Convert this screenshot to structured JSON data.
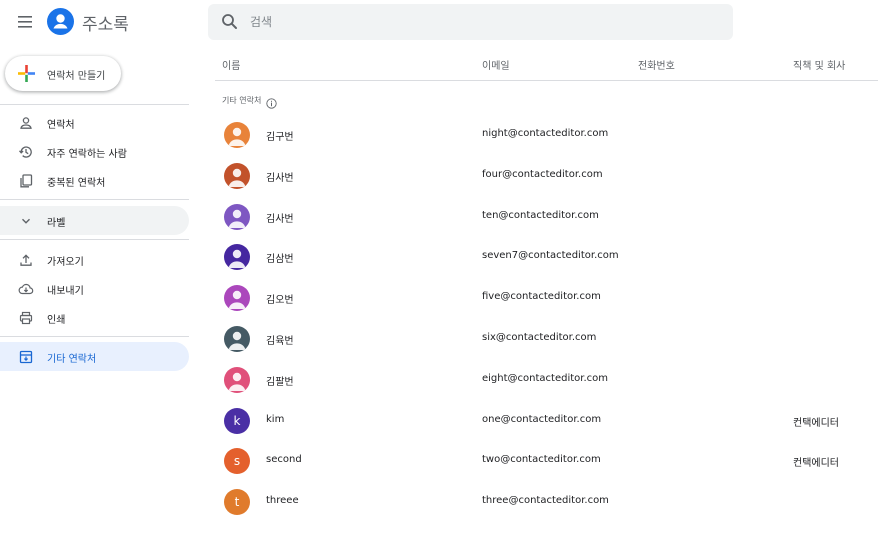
{
  "app": {
    "title": "주소록"
  },
  "search": {
    "placeholder": "검색"
  },
  "sidebar": {
    "create_label": "연락처 만들기",
    "items": [
      {
        "label": "연락처",
        "icon": "person-icon"
      },
      {
        "label": "자주 연락하는 사람",
        "icon": "history-icon"
      },
      {
        "label": "중복된 연락처",
        "icon": "copy-icon"
      },
      {
        "label": "라벨",
        "icon": "chevron-down-icon"
      },
      {
        "label": "가져오기",
        "icon": "upload-icon"
      },
      {
        "label": "내보내기",
        "icon": "cloud-download-icon"
      },
      {
        "label": "인쇄",
        "icon": "print-icon"
      },
      {
        "label": "기타 연락처",
        "icon": "archive-icon"
      }
    ]
  },
  "list": {
    "columns": {
      "name": "이름",
      "email": "이메일",
      "phone": "전화번호",
      "company": "직책 및 회사"
    },
    "section_title": "기타 연락처",
    "rows": [
      {
        "name": "김구번",
        "email": "night@contacteditor.com",
        "company": "",
        "avatar_color": "#e8833a",
        "letter": ""
      },
      {
        "name": "김사번",
        "email": "four@contacteditor.com",
        "company": "",
        "avatar_color": "#c2522b",
        "letter": ""
      },
      {
        "name": "김사번",
        "email": "ten@contacteditor.com",
        "company": "",
        "avatar_color": "#7e57c2",
        "letter": ""
      },
      {
        "name": "김삼번",
        "email": "seven7@contacteditor.com",
        "company": "",
        "avatar_color": "#4527a0",
        "letter": ""
      },
      {
        "name": "김오번",
        "email": "five@contacteditor.com",
        "company": "",
        "avatar_color": "#ab47bc",
        "letter": ""
      },
      {
        "name": "김육번",
        "email": "six@contacteditor.com",
        "company": "",
        "avatar_color": "#455a64",
        "letter": ""
      },
      {
        "name": "김팔번",
        "email": "eight@contacteditor.com",
        "company": "",
        "avatar_color": "#e0507a",
        "letter": ""
      },
      {
        "name": "kim",
        "email": "one@contacteditor.com",
        "company": "컨택에디터",
        "avatar_color": "#4a2fa5",
        "letter": "k"
      },
      {
        "name": "second",
        "email": "two@contacteditor.com",
        "company": "컨택에디터",
        "avatar_color": "#e4602d",
        "letter": "s"
      },
      {
        "name": "threee",
        "email": "three@contacteditor.com",
        "company": "",
        "avatar_color": "#e07b2c",
        "letter": "t"
      }
    ]
  },
  "colors": {
    "accent": "#1a73e8",
    "active_bg": "#e8f0fe",
    "active_text": "#1967d2"
  }
}
